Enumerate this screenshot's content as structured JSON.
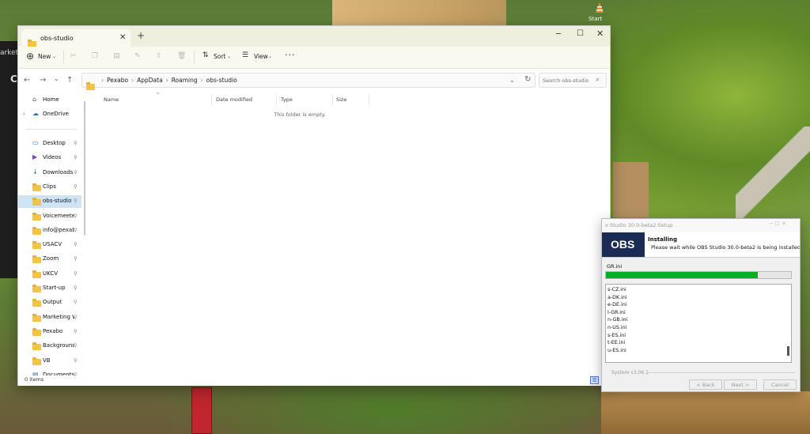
{
  "desktop": {
    "side_text": "arketpl",
    "side_letter": "C",
    "vlc_label": "Start"
  },
  "explorer": {
    "tab_title": "obs-studio",
    "tab_close": "✕",
    "new_tab": "+",
    "window_controls": {
      "minimize": "─",
      "maximize": "☐",
      "close": "✕"
    },
    "toolbar": {
      "new_icon": "⊕",
      "new_label": "New",
      "dropdown_chevron": "⌄",
      "sort_icon": "⇅",
      "sort_label": "Sort",
      "view_icon": "☰",
      "view_label": "View",
      "more_label": "···",
      "disabled_icons": [
        "cut-icon",
        "copy-icon",
        "paste-icon",
        "rename-icon",
        "share-icon",
        "delete-icon"
      ]
    },
    "nav_buttons": {
      "back": "←",
      "forward": "→",
      "recent": "⌄",
      "up": "↑"
    },
    "address": {
      "breadcrumbs": [
        "Pexabo",
        "AppData",
        "Roaming",
        "obs-studio"
      ],
      "separator": "›",
      "chevron": "⌄",
      "refresh": "↻"
    },
    "search": {
      "placeholder": "Search obs-studio",
      "icon": "⌕"
    },
    "nav_pane": {
      "quick": [
        {
          "label": "Home",
          "icon": "home-icon"
        },
        {
          "label": "OneDrive",
          "icon": "cloud-icon"
        }
      ],
      "pinned": [
        {
          "label": "Desktop",
          "icon": "desktop-icon"
        },
        {
          "label": "Videos",
          "icon": "videos-icon"
        },
        {
          "label": "Downloads",
          "icon": "download-icon"
        },
        {
          "label": "Clips",
          "icon": "folder-icon"
        },
        {
          "label": "obs-studio",
          "icon": "folder-icon",
          "selected": true
        },
        {
          "label": "Voicemeeter",
          "icon": "folder-icon"
        },
        {
          "label": "info@pexabo",
          "icon": "folder-icon"
        },
        {
          "label": "USACV",
          "icon": "folder-icon"
        },
        {
          "label": "Zoom",
          "icon": "folder-icon"
        },
        {
          "label": "UKCV",
          "icon": "folder-icon"
        },
        {
          "label": "Start-up",
          "icon": "folder-icon"
        },
        {
          "label": "Output",
          "icon": "folder-icon"
        },
        {
          "label": "Marketing W",
          "icon": "folder-icon"
        },
        {
          "label": "Pexabo",
          "icon": "folder-icon"
        },
        {
          "label": "Backgrounds",
          "icon": "folder-icon"
        },
        {
          "label": "VB",
          "icon": "folder-icon"
        },
        {
          "label": "Documents",
          "icon": "documents-icon"
        }
      ],
      "pin_glyph": "📌"
    },
    "columns": [
      "Name",
      "Date modified",
      "Type",
      "Size"
    ],
    "sort_indicator": "^",
    "empty_message": "This folder is empty.",
    "status": {
      "item_count": "0 items"
    }
  },
  "installer": {
    "title": "o Studio 30.0-beta2 Setup",
    "controls": "─  ☐  ✕",
    "logo": "OBS",
    "heading": "Installing",
    "subheading": "Please wait while OBS Studio 30.0-beta2 is being installed.",
    "current_file": "GR.ini",
    "progress": 0.82,
    "progress_color": "#06b025",
    "log_lines": [
      "s-CZ.ini",
      "a-DK.ini",
      "e-DE.ini",
      "l-GR.ini",
      "n-GB.ini",
      "n-US.ini",
      "s-ES.ini",
      "t-EE.ini",
      "u-ES.ini"
    ],
    "branding": "System v3.06.1",
    "buttons": {
      "back": "< Back",
      "next": "Next >",
      "cancel": "Cancel"
    }
  }
}
